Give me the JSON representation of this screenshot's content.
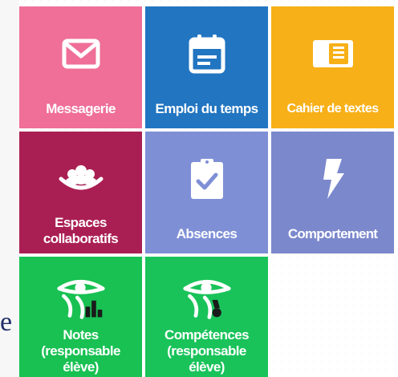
{
  "tiles": [
    {
      "key": "messagerie",
      "label_lines": [
        "Messagerie"
      ],
      "color": "#ef6f99",
      "icon": "mail-icon"
    },
    {
      "key": "emploi",
      "label_lines": [
        "Emploi du temps"
      ],
      "color": "#2275c1",
      "icon": "calendar-icon"
    },
    {
      "key": "cahier",
      "label_lines": [
        "Cahier de textes"
      ],
      "color": "#f7b017",
      "icon": "notebook-icon"
    },
    {
      "key": "espaces",
      "label_lines": [
        "Espaces",
        "collaboratifs"
      ],
      "color": "#aa1f53",
      "icon": "group-icon"
    },
    {
      "key": "absences",
      "label_lines": [
        "Absences"
      ],
      "color": "#7f8fd6",
      "icon": "clipboard-check-icon"
    },
    {
      "key": "comportement",
      "label_lines": [
        "Comportement"
      ],
      "color": "#7b88cc",
      "icon": "lightning-icon"
    },
    {
      "key": "notes",
      "label_lines": [
        "Notes",
        "(responsable",
        "élève)"
      ],
      "color": "#18c152",
      "icon": "eye-chart-icon"
    },
    {
      "key": "competences",
      "label_lines": [
        "Compétences",
        "(responsable",
        "élève)"
      ],
      "color": "#19c35a",
      "icon": "eye-medal-icon"
    }
  ],
  "edge": {
    "glyph": "e"
  }
}
